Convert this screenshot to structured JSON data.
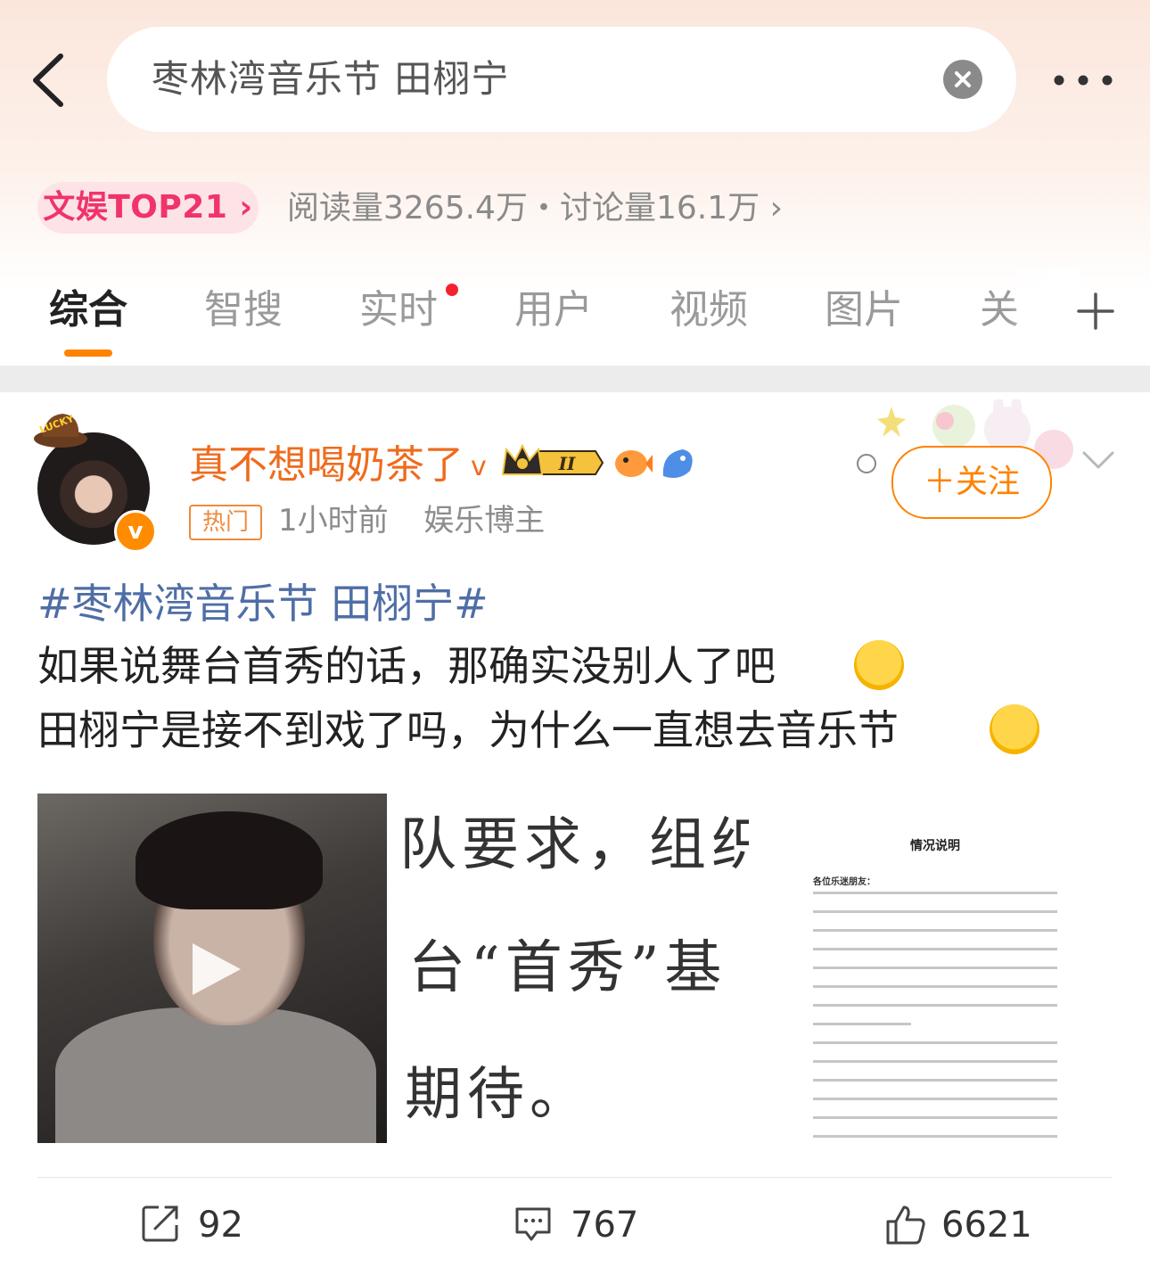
{
  "search": {
    "query": "枣林湾音乐节 田栩宁"
  },
  "topic_stats": {
    "rank_badge": "文娱TOP21",
    "stats_text": "阅读量3265.4万・讨论量16.1万"
  },
  "tabs": [
    {
      "label": "综合",
      "active": true
    },
    {
      "label": "智搜"
    },
    {
      "label": "实时",
      "has_dot": true
    },
    {
      "label": "用户"
    },
    {
      "label": "视频"
    },
    {
      "label": "图片"
    },
    {
      "label": "关"
    }
  ],
  "post": {
    "author": "真不想喝奶茶了",
    "verified_mark": "v",
    "avatar_badge": "v",
    "avatar_sticker": "LUCKY",
    "crown_level": "II",
    "hot_tag": "热门",
    "time": "1小时前",
    "role": "娱乐博主",
    "follow_label": "＋关注",
    "topic": "#枣林湾音乐节 田栩宁#",
    "lines": [
      "如果说舞台首秀的话，那确实没别人了吧",
      "田栩宁是接不到戏了吗，为什么一直想去音乐节"
    ],
    "image2_lines": [
      "队要求，组织",
      "台“首秀”基",
      "期待。"
    ],
    "image3_title": "情况说明",
    "image3_greeting": "各位乐迷朋友：",
    "actions": {
      "repost": "92",
      "comment": "767",
      "like": "6621"
    }
  },
  "colors": {
    "accent": "#ff8200",
    "author": "#ef6b1d",
    "topic": "#4f6ea6",
    "rank": "#f0346a"
  },
  "icons": [
    "back-icon",
    "clear-icon",
    "more-icon",
    "chevron-right-icon",
    "plus-icon",
    "play-icon",
    "repost-icon",
    "comment-icon",
    "like-icon",
    "chevron-down-icon"
  ]
}
